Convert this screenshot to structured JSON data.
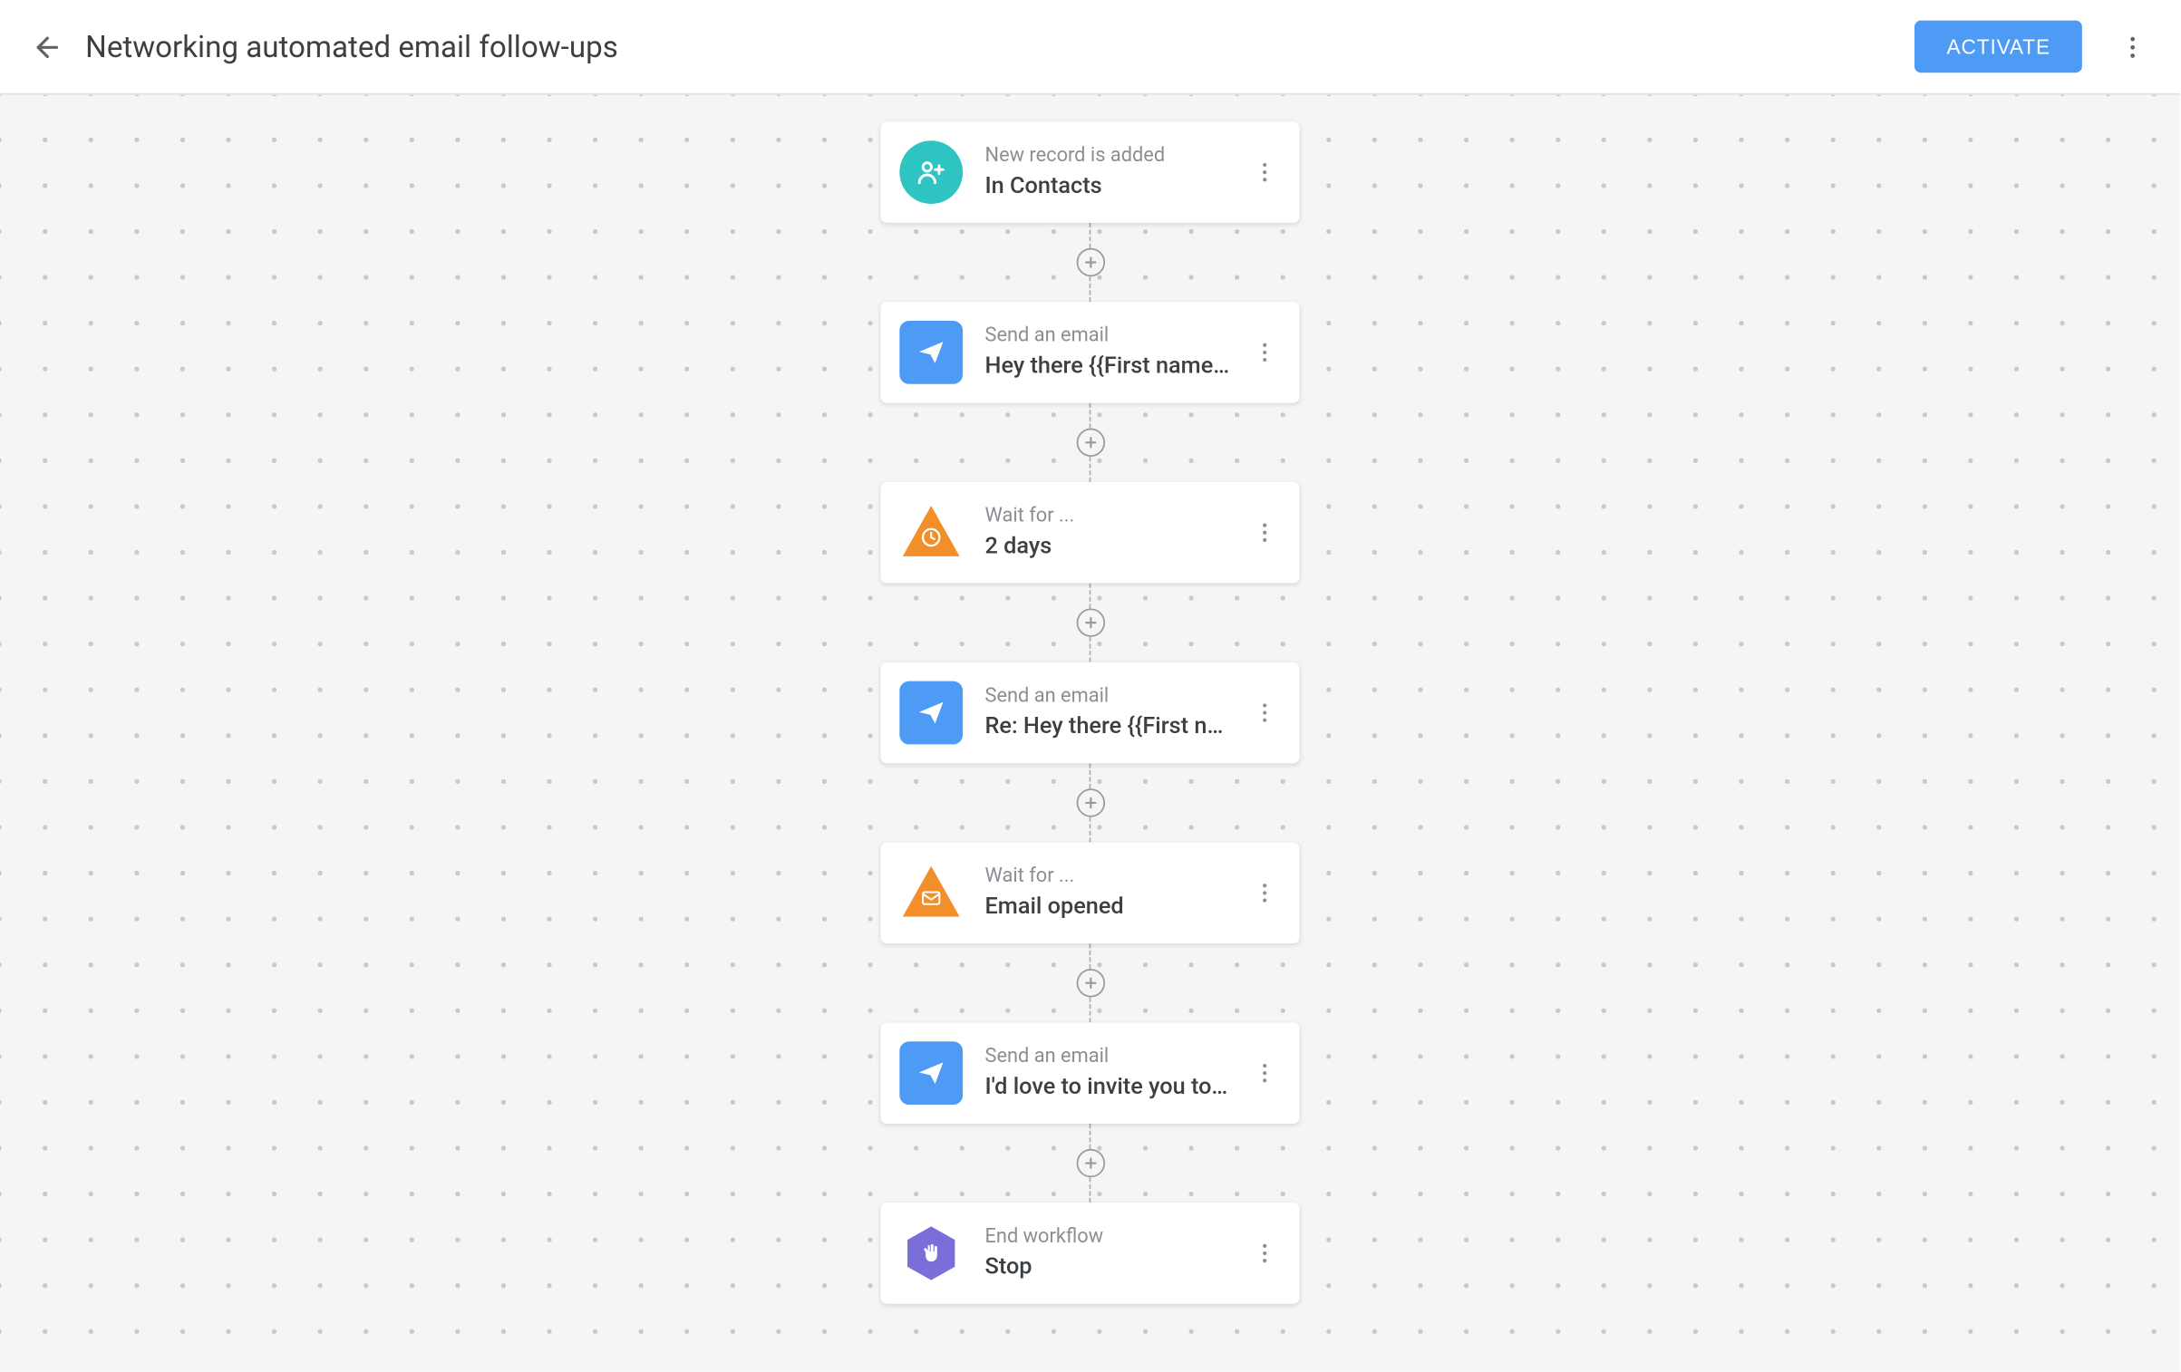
{
  "header": {
    "title": "Networking automated email follow-ups",
    "activate_label": "ACTIVATE"
  },
  "workflow": {
    "nodes": [
      {
        "label": "New record is added",
        "value": "In Contacts",
        "icon": "person-add",
        "shape": "circle",
        "color": "#2ec4c1"
      },
      {
        "label": "Send an email",
        "value": "Hey there {{First name…",
        "icon": "send",
        "shape": "rounded",
        "color": "#4e9bf5"
      },
      {
        "label": "Wait for ...",
        "value": "2 days",
        "icon": "clock",
        "shape": "triangle",
        "color": "#f28f2b"
      },
      {
        "label": "Send an email",
        "value": "Re: Hey there {{First n…",
        "icon": "send",
        "shape": "rounded",
        "color": "#4e9bf5"
      },
      {
        "label": "Wait for ...",
        "value": "Email opened",
        "icon": "mail",
        "shape": "triangle",
        "color": "#f28f2b"
      },
      {
        "label": "Send an email",
        "value": "I'd love to invite you to…",
        "icon": "send",
        "shape": "rounded",
        "color": "#4e9bf5"
      },
      {
        "label": "End workflow",
        "value": "Stop",
        "icon": "hand",
        "shape": "hexagon",
        "color": "#7a6fd8"
      }
    ]
  }
}
